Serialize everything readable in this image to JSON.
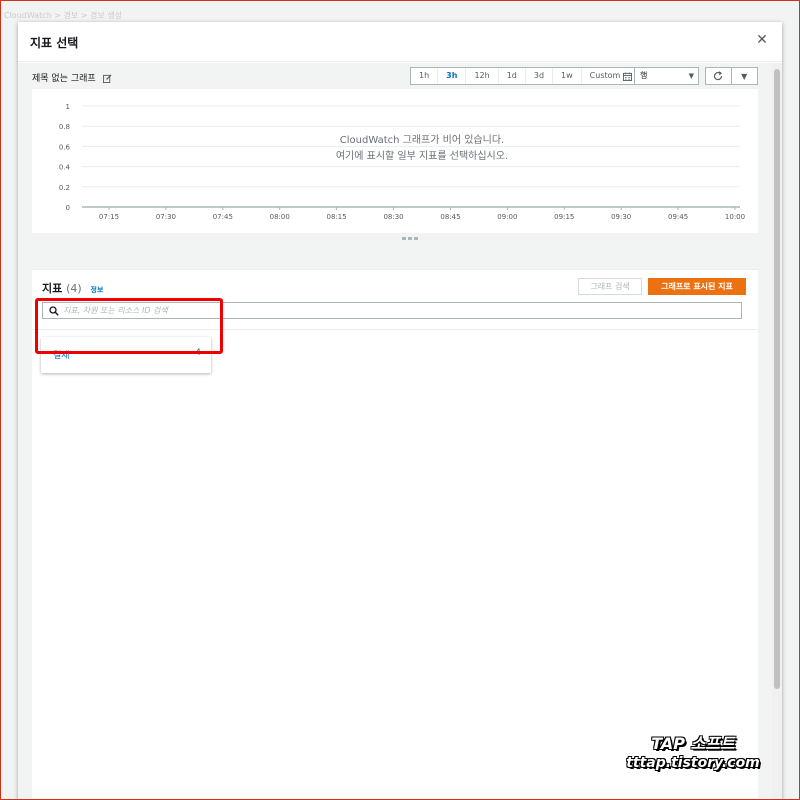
{
  "background": {
    "breadcrumb": "CloudWatch  >  경보  >  경보 생성"
  },
  "modal": {
    "title": "지표 선택",
    "close_icon": "close-icon"
  },
  "graph": {
    "title": "제목 없는 그래프",
    "edit_icon": "edit-icon",
    "time_ranges": [
      {
        "label": "1h",
        "active": false
      },
      {
        "label": "3h",
        "active": true
      },
      {
        "label": "12h",
        "active": false
      },
      {
        "label": "1d",
        "active": false
      },
      {
        "label": "3d",
        "active": false
      },
      {
        "label": "1w",
        "active": false
      },
      {
        "label": "Custom",
        "active": false
      }
    ],
    "calendar_icon": "calendar-icon",
    "graph_type": "행",
    "refresh_icon": "refresh-icon",
    "empty_line1": "CloudWatch 그래프가 비어 있습니다.",
    "empty_line2": "여기에 표시할 일부 지표를 선택하십시오."
  },
  "chart_data": {
    "type": "line",
    "title": "",
    "xlabel": "",
    "ylabel": "",
    "x": [
      "07:15",
      "07:30",
      "07:45",
      "08:00",
      "08:15",
      "08:30",
      "08:45",
      "09:00",
      "09:15",
      "09:30",
      "09:45",
      "10:00"
    ],
    "yticks": [
      "1",
      "0.8",
      "0.6",
      "0.4",
      "0.2",
      "0"
    ],
    "ylim": [
      0,
      1
    ],
    "grid": true,
    "series": []
  },
  "metrics": {
    "title": "지표",
    "count": "(4)",
    "info_label": "정보",
    "graph_search_label": "그래프 검색",
    "graphed_metrics_label": "그래프로 표시된 지표",
    "search_placeholder": "지표, 차원 또는 리소스 ID 검색",
    "namespaces": [
      {
        "name": "결제",
        "count": "4"
      }
    ]
  },
  "watermark": {
    "line1": "TAP 소프트",
    "line2": "tttap.tistory.com"
  },
  "colors": {
    "accent_orange": "#ec7211",
    "link_blue": "#0073bb",
    "highlight_red": "#ee0000"
  }
}
